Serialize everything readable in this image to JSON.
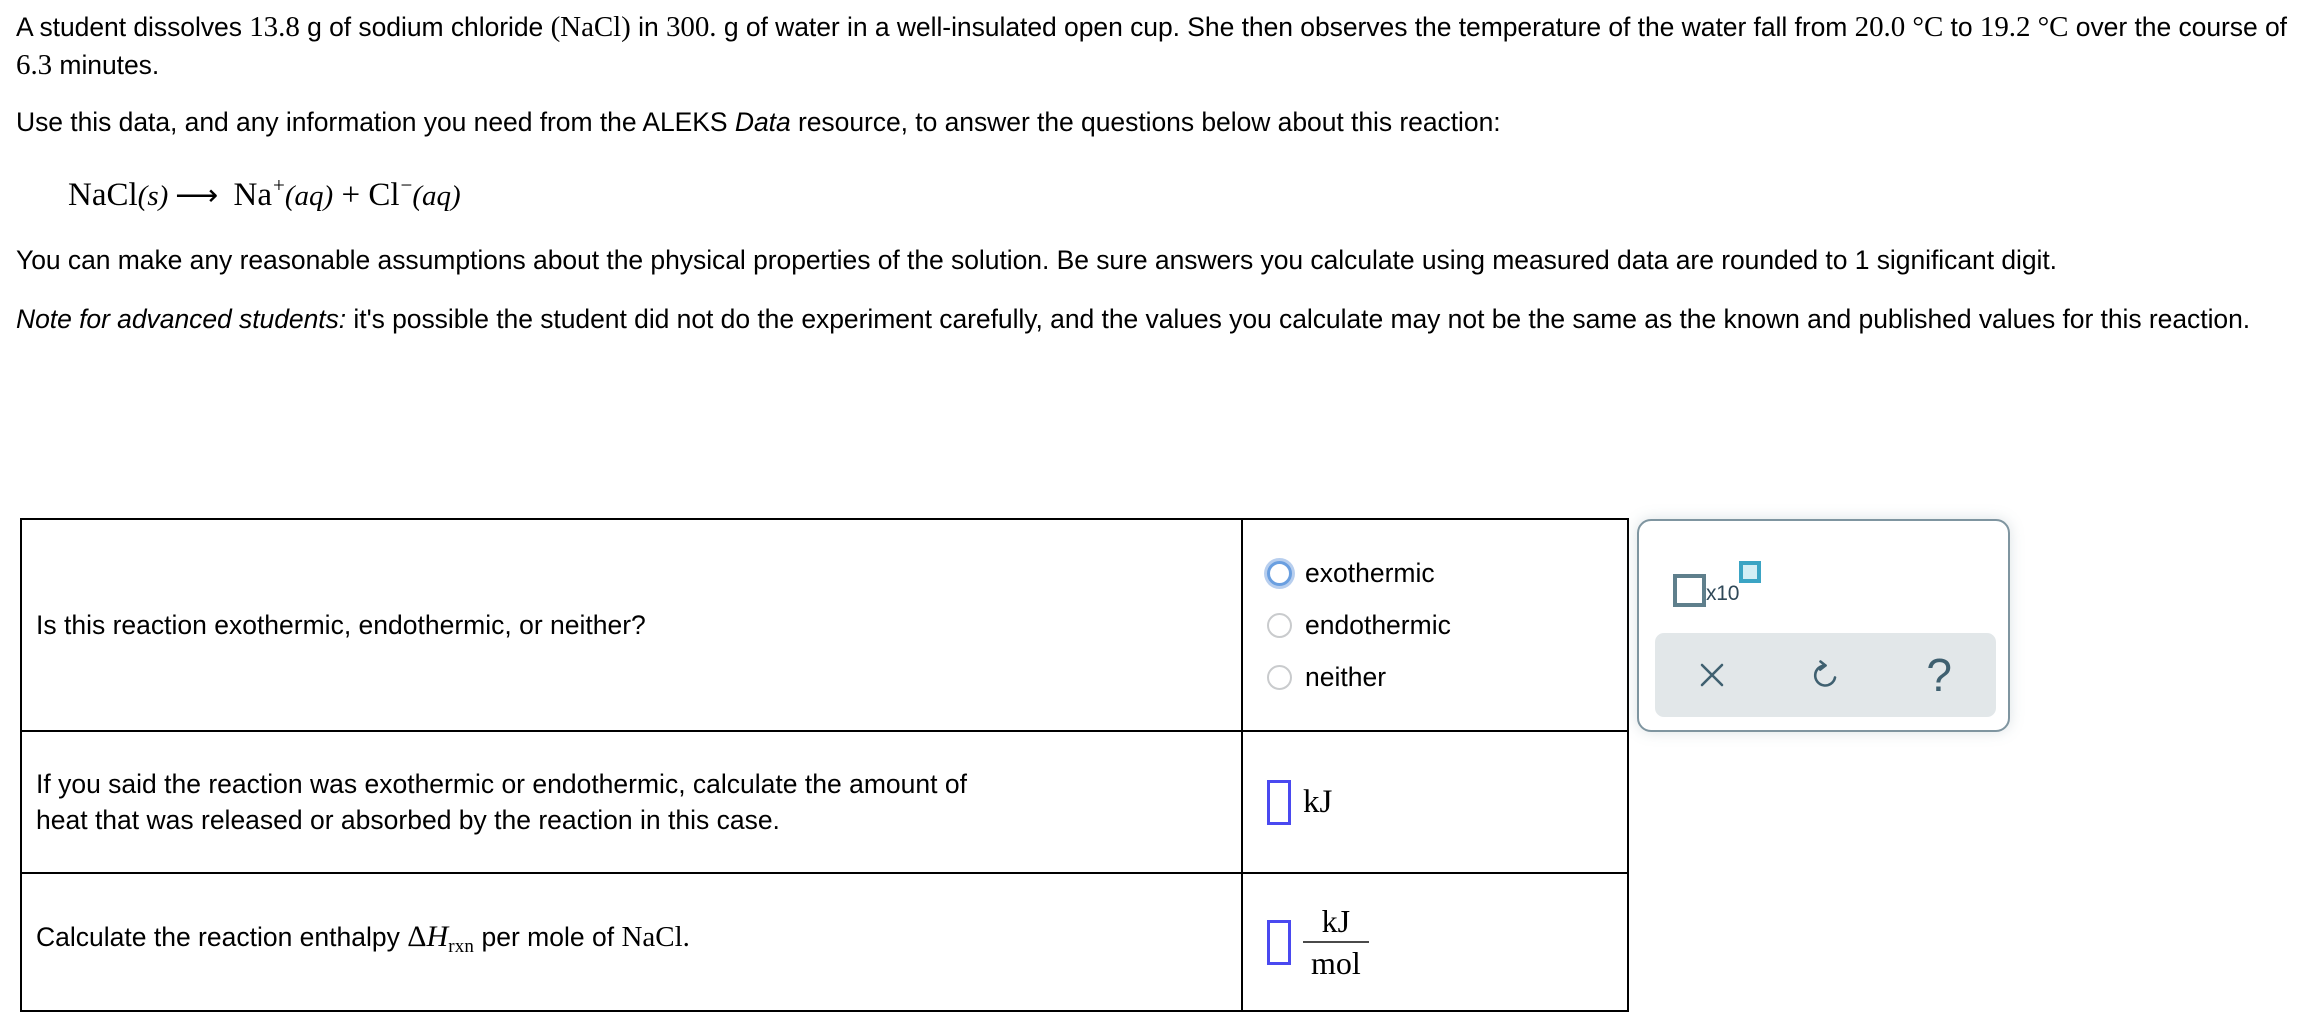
{
  "problem": {
    "paragraph1": {
      "seg1": "A student dissolves ",
      "math1": "13.8",
      "seg2": " g of sodium chloride ",
      "math2": "(NaCl)",
      "seg3": " in ",
      "math3": "300.",
      "seg4": " g of water in a well-insulated open cup. She then observes the temperature of the water fall from ",
      "math4": "20.0 °C",
      "seg5": " to ",
      "math5": "19.2 °C",
      "seg6": " over the course of ",
      "math6": "6.3",
      "seg7": " minutes."
    },
    "paragraph2": {
      "seg1": "Use this data, and any information you need from the ALEKS ",
      "emphasis": "Data",
      "seg2": " resource, to answer the questions below about this reaction:"
    },
    "equation": {
      "reactant": "NaCl",
      "reactant_state": "(s)",
      "arrow": "⟶",
      "product1": "Na",
      "product1_charge": "+",
      "product1_state": "(aq)",
      "plus": "+",
      "product2": "Cl",
      "product2_charge": "−",
      "product2_state": "(aq)"
    },
    "paragraph3": "You can make any reasonable assumptions about the physical properties of the solution. Be sure answers you calculate using measured data are rounded to 1 significant digit.",
    "paragraph4": {
      "note_label": "Note for advanced students:",
      "note_text": " it's possible the student did not do the experiment carefully, and the values you calculate may not be the same as the known and published values for this reaction."
    }
  },
  "table": {
    "rows": [
      {
        "question": "Is this reaction exothermic, endothermic, or neither?",
        "answer_type": "radio",
        "options": [
          {
            "label": "exothermic",
            "state": "focused"
          },
          {
            "label": "endothermic",
            "state": "plain"
          },
          {
            "label": "neither",
            "state": "plain"
          }
        ]
      },
      {
        "question_line1": "If you said the reaction was exothermic or endothermic, calculate the amount of",
        "question_line2": "heat that was released or absorbed by the reaction in this case.",
        "answer_type": "input-unit",
        "input_value": "",
        "unit": "kJ"
      },
      {
        "question_prefix": "Calculate the reaction enthalpy ",
        "question_symbol_delta": "Δ",
        "question_symbol_H": "H",
        "question_symbol_sub": "rxn",
        "question_suffix_sans": " per mole of ",
        "question_suffix_serif": "NaCl.",
        "answer_type": "input-fraction",
        "input_value": "",
        "unit_numerator": "kJ",
        "unit_denominator": "mol"
      }
    ]
  },
  "toolpanel": {
    "scientific_notation": {
      "base_placeholder": "",
      "multiplier_label": "x10",
      "exponent_placeholder": ""
    },
    "actions": [
      {
        "name": "clear",
        "glyph": "×"
      },
      {
        "name": "undo",
        "glyph": "↺"
      },
      {
        "name": "help",
        "glyph": "?"
      }
    ]
  },
  "colors": {
    "input_border": "#4a49f0",
    "radio_focus": "#6a9fe0",
    "radio_plain": "#c9cbcd",
    "panel_border": "#7f95a0",
    "action_bar_bg": "#e2e7e9",
    "icon": "#3f6070",
    "sci_square_border": "#5f7f8c",
    "sci_exponent_border": "#3ba4c4",
    "sci_exponent_fill": "#d4eef5"
  }
}
